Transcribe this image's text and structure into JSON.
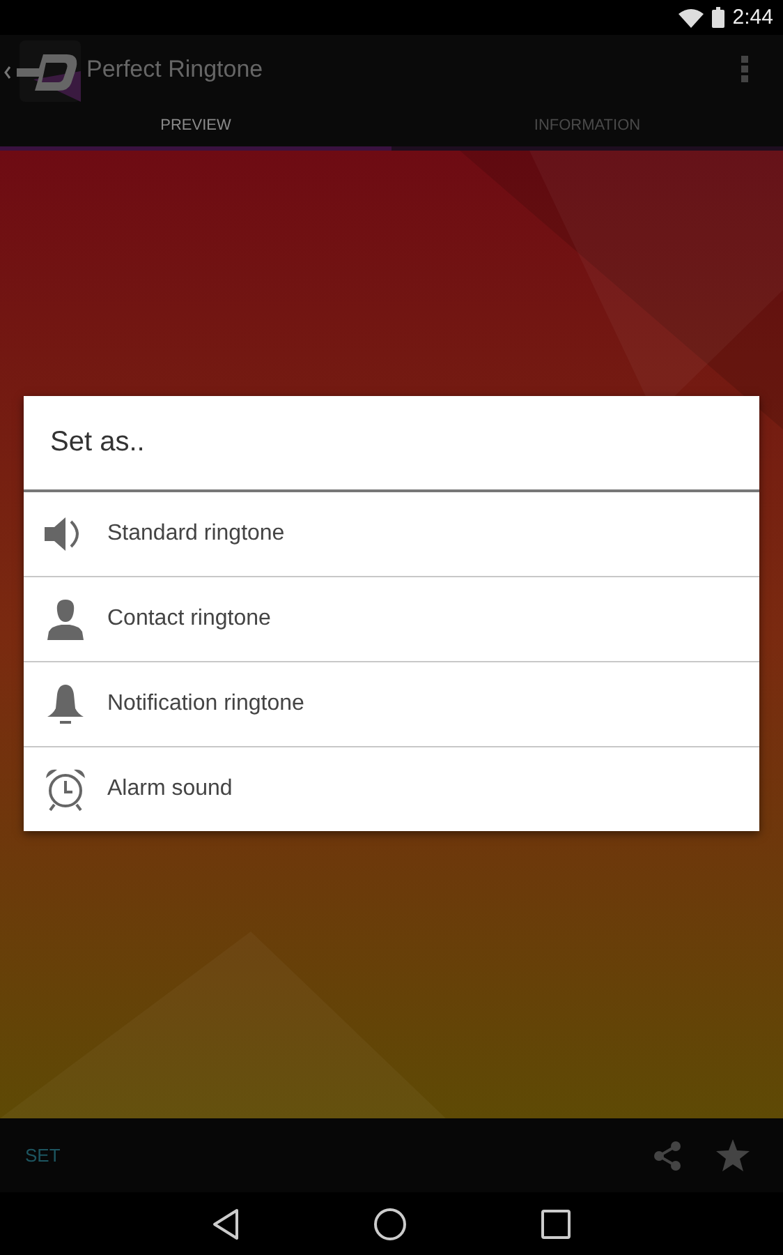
{
  "status_bar": {
    "time": "2:44"
  },
  "action_bar": {
    "title": "Perfect Ringtone"
  },
  "tabs": [
    {
      "label": "PREVIEW",
      "selected": true
    },
    {
      "label": "INFORMATION",
      "selected": false
    }
  ],
  "dialog": {
    "title": "Set as..",
    "options": [
      {
        "label": "Standard ringtone",
        "kind": "speaker"
      },
      {
        "label": "Contact ringtone",
        "kind": "person"
      },
      {
        "label": "Notification ringtone",
        "kind": "bell"
      },
      {
        "label": "Alarm sound",
        "kind": "alarm"
      }
    ]
  },
  "bottom_bar": {
    "action": "SET"
  }
}
